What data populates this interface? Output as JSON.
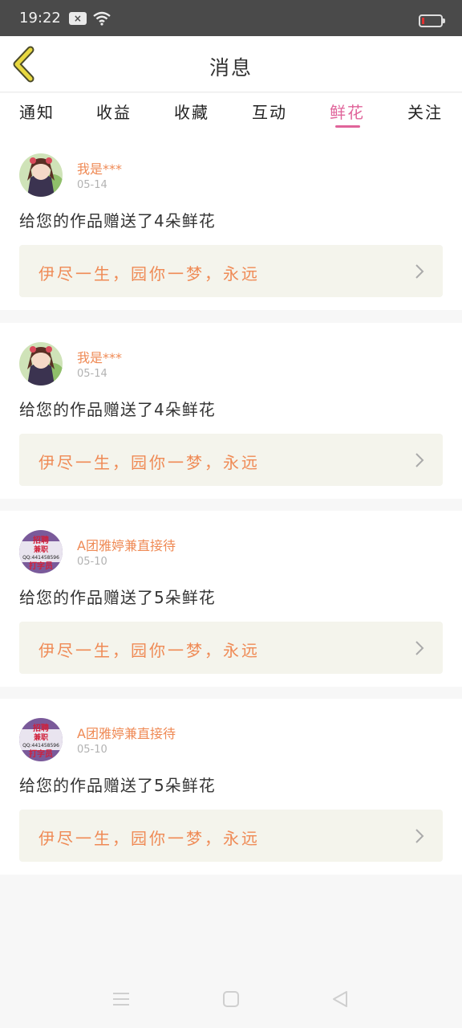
{
  "status_bar": {
    "time": "19:22",
    "icons": [
      "close-notification-icon",
      "wifi-icon",
      "battery-low-icon"
    ],
    "battery_color": "#e03030"
  },
  "header": {
    "title": "消息",
    "back_icon": "chevron-left-icon",
    "back_color": "#e8d840"
  },
  "tabs": {
    "items": [
      "通知",
      "收益",
      "收藏",
      "互动",
      "鲜花",
      "关注"
    ],
    "active_index": 4,
    "active_color": "#e0649a"
  },
  "messages": [
    {
      "username": "我是***",
      "date": "05-14",
      "text": "给您的作品赠送了4朵鲜花",
      "work_title": "伊尽一生，园你一梦，永远",
      "avatar": "anime-girl-avatar"
    },
    {
      "username": "我是***",
      "date": "05-14",
      "text": "给您的作品赠送了4朵鲜花",
      "work_title": "伊尽一生，园你一梦，永远",
      "avatar": "anime-girl-avatar"
    },
    {
      "username": "A团雅婷兼直接待",
      "date": "05-10",
      "text": "给您的作品赠送了5朵鲜花",
      "work_title": "伊尽一生，园你一梦，永远",
      "avatar": "recruitment-badge-avatar",
      "avatar_text": [
        "招聘",
        "兼职",
        "QQ:441458596",
        "打字员"
      ]
    },
    {
      "username": "A团雅婷兼直接待",
      "date": "05-10",
      "text": "给您的作品赠送了5朵鲜花",
      "work_title": "伊尽一生，园你一梦，永远",
      "avatar": "recruitment-badge-avatar",
      "avatar_text": [
        "招聘",
        "兼职",
        "QQ:441458596",
        "打字员"
      ]
    }
  ],
  "nav_bar": {
    "icons": [
      "menu-icon",
      "home-square-icon",
      "back-triangle-icon"
    ]
  }
}
